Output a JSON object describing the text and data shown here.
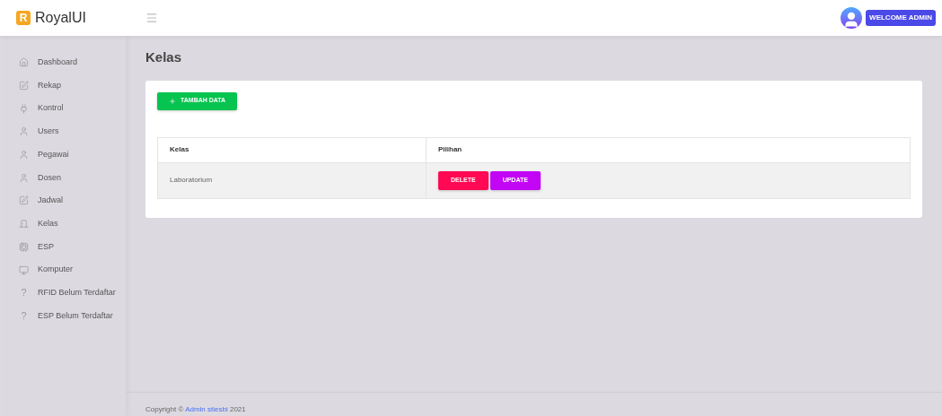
{
  "brand": {
    "logo_letter": "R",
    "name": "RoyalUI"
  },
  "user_badge": "WELCOME ADMIN",
  "sidebar": {
    "items": [
      {
        "kind": "home",
        "label": "Dashboard"
      },
      {
        "kind": "edit",
        "label": "Rekap"
      },
      {
        "kind": "plug",
        "label": "Kontrol"
      },
      {
        "kind": "user",
        "label": "Users"
      },
      {
        "kind": "user",
        "label": "Pegawai"
      },
      {
        "kind": "user",
        "label": "Dosen"
      },
      {
        "kind": "edit",
        "label": "Jadwal"
      },
      {
        "kind": "door",
        "label": "Kelas"
      },
      {
        "kind": "chip",
        "label": "ESP"
      },
      {
        "kind": "monitor",
        "label": "Komputer"
      },
      {
        "kind": "glyph",
        "glyph": "?",
        "label": "RFID Belum Terdaftar"
      },
      {
        "kind": "glyph",
        "glyph": "?",
        "label": "ESP Belum Terdaftar"
      }
    ]
  },
  "page_title": "Kelas",
  "add_button": "TAMBAH DATA",
  "table": {
    "columns": [
      "Kelas",
      "Pilihan"
    ],
    "rows": [
      {
        "kelas": "Laboratorium",
        "actions": [
          "DELETE",
          "UPDATE"
        ]
      }
    ]
  },
  "footer": {
    "prefix": "Copyright ©",
    "link": "Admin stiesbi",
    "suffix": "2021"
  }
}
